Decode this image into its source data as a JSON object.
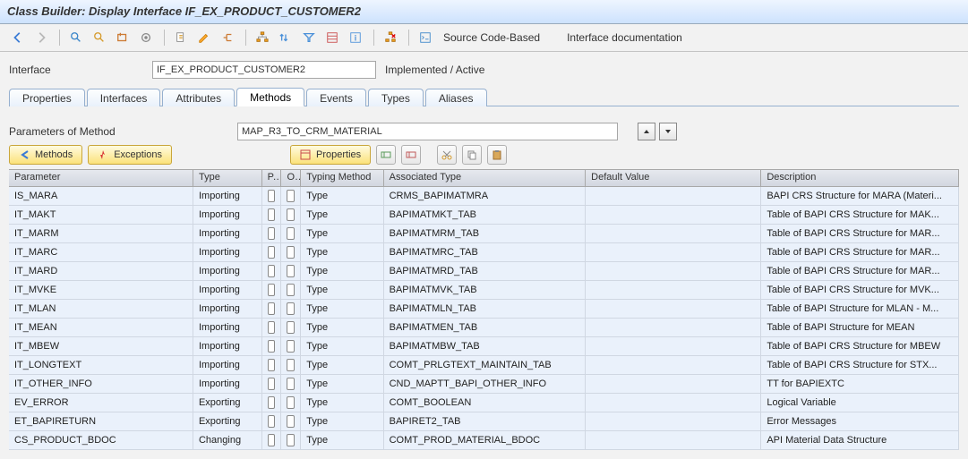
{
  "title": "Class Builder: Display Interface IF_EX_PRODUCT_CUSTOMER2",
  "interface_label": "Interface",
  "interface_name": "IF_EX_PRODUCT_CUSTOMER2",
  "status": "Implemented / Active",
  "tabs": [
    "Properties",
    "Interfaces",
    "Attributes",
    "Methods",
    "Events",
    "Types",
    "Aliases"
  ],
  "active_tab": 3,
  "param_label": "Parameters of Method",
  "method_name": "MAP_R3_TO_CRM_MATERIAL",
  "buttons": {
    "methods": "Methods",
    "exceptions": "Exceptions",
    "properties": "Properties",
    "source_code": "Source Code-Based",
    "docu": "Interface documentation"
  },
  "columns": [
    "Parameter",
    "Type",
    "P...",
    "O...",
    "Typing Method",
    "Associated Type",
    "Default Value",
    "Description"
  ],
  "rows": [
    {
      "param": "IS_MARA",
      "type": "Importing",
      "tm": "Type",
      "assoc": "CRMS_BAPIMATMRA",
      "def": "",
      "desc": "BAPI CRS Structure for MARA (Materi..."
    },
    {
      "param": "IT_MAKT",
      "type": "Importing",
      "tm": "Type",
      "assoc": "BAPIMATMKT_TAB",
      "def": "",
      "desc": "Table of BAPI CRS Structure for MAK..."
    },
    {
      "param": "IT_MARM",
      "type": "Importing",
      "tm": "Type",
      "assoc": "BAPIMATMRM_TAB",
      "def": "",
      "desc": "Table of BAPI CRS Structure for MAR..."
    },
    {
      "param": "IT_MARC",
      "type": "Importing",
      "tm": "Type",
      "assoc": "BAPIMATMRC_TAB",
      "def": "",
      "desc": "Table of BAPI CRS Structure for MAR..."
    },
    {
      "param": "IT_MARD",
      "type": "Importing",
      "tm": "Type",
      "assoc": "BAPIMATMRD_TAB",
      "def": "",
      "desc": "Table of BAPI CRS Structure for MAR..."
    },
    {
      "param": "IT_MVKE",
      "type": "Importing",
      "tm": "Type",
      "assoc": "BAPIMATMVK_TAB",
      "def": "",
      "desc": "Table of BAPI CRS Structure for MVK..."
    },
    {
      "param": "IT_MLAN",
      "type": "Importing",
      "tm": "Type",
      "assoc": "BAPIMATMLN_TAB",
      "def": "",
      "desc": "Table of BAPI Structure for MLAN - M..."
    },
    {
      "param": "IT_MEAN",
      "type": "Importing",
      "tm": "Type",
      "assoc": "BAPIMATMEN_TAB",
      "def": "",
      "desc": "Table of BAPI Structure for MEAN"
    },
    {
      "param": "IT_MBEW",
      "type": "Importing",
      "tm": "Type",
      "assoc": "BAPIMATMBW_TAB",
      "def": "",
      "desc": "Table of BAPI CRS Structure for MBEW"
    },
    {
      "param": "IT_LONGTEXT",
      "type": "Importing",
      "tm": "Type",
      "assoc": "COMT_PRLGTEXT_MAINTAIN_TAB",
      "def": "",
      "desc": "Table of BAPI CRS Structure for STX..."
    },
    {
      "param": "IT_OTHER_INFO",
      "type": "Importing",
      "tm": "Type",
      "assoc": "CND_MAPTT_BAPI_OTHER_INFO",
      "def": "",
      "desc": "TT for BAPIEXTC"
    },
    {
      "param": "EV_ERROR",
      "type": "Exporting",
      "tm": "Type",
      "assoc": "COMT_BOOLEAN",
      "def": "",
      "desc": "Logical Variable"
    },
    {
      "param": "ET_BAPIRETURN",
      "type": "Exporting",
      "tm": "Type",
      "assoc": "BAPIRET2_TAB",
      "def": "",
      "desc": "Error Messages"
    },
    {
      "param": "CS_PRODUCT_BDOC",
      "type": "Changing",
      "tm": "Type",
      "assoc": "COMT_PROD_MATERIAL_BDOC",
      "def": "",
      "desc": "API Material Data Structure"
    }
  ]
}
